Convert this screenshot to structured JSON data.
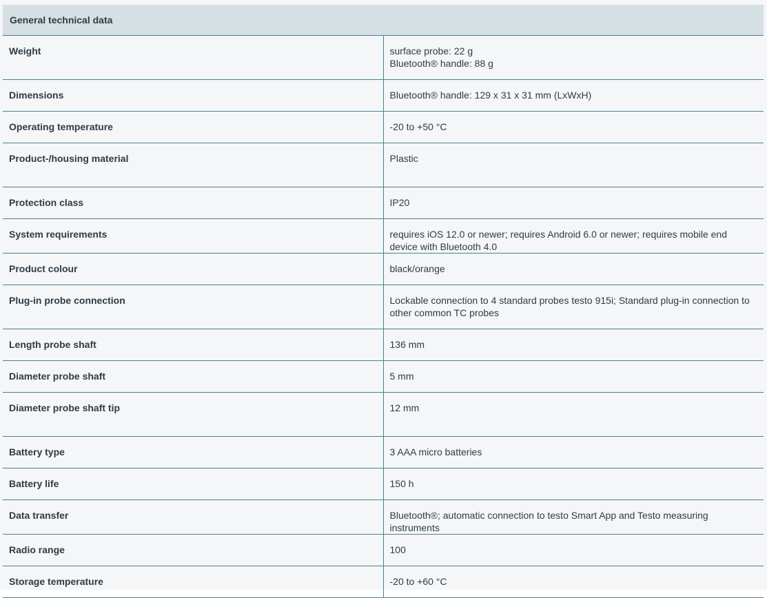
{
  "table": {
    "title": "General technical data",
    "rows": [
      {
        "label": "Weight",
        "value_lines": [
          "surface probe: 22 g",
          "Bluetooth® handle: 88 g"
        ]
      },
      {
        "label": "Dimensions",
        "value": "Bluetooth® handle: 129 x 31 x 31 mm (LxWxH)"
      },
      {
        "label": "Operating temperature",
        "value": "-20 to +50 °C"
      },
      {
        "label": "Product-/housing material",
        "value": "Plastic"
      },
      {
        "label": "Protection class",
        "value": "IP20"
      },
      {
        "label": "System requirements",
        "value": "requires iOS 12.0 or newer; requires Android 6.0 or newer; requires mobile end device with Bluetooth 4.0"
      },
      {
        "label": "Product colour",
        "value": "black/orange"
      },
      {
        "label": "Plug-in probe connection",
        "value": "Lockable connection to 4 standard probes testo 915i; Standard plug-in connection to other common TC probes"
      },
      {
        "label": "Length probe shaft",
        "value": "136 mm"
      },
      {
        "label": "Diameter probe shaft",
        "value": "5 mm"
      },
      {
        "label": "Diameter probe shaft tip",
        "value": "12 mm"
      },
      {
        "label": "Battery type",
        "value": "3 AAA micro batteries"
      },
      {
        "label": "Battery life",
        "value": "150 h"
      },
      {
        "label": "Data transfer",
        "value": "Bluetooth®; automatic connection to testo Smart App and Testo measuring instruments"
      },
      {
        "label": "Radio range",
        "value": "100"
      },
      {
        "label": "Storage temperature",
        "value": "-20 to +60 °C"
      }
    ]
  }
}
